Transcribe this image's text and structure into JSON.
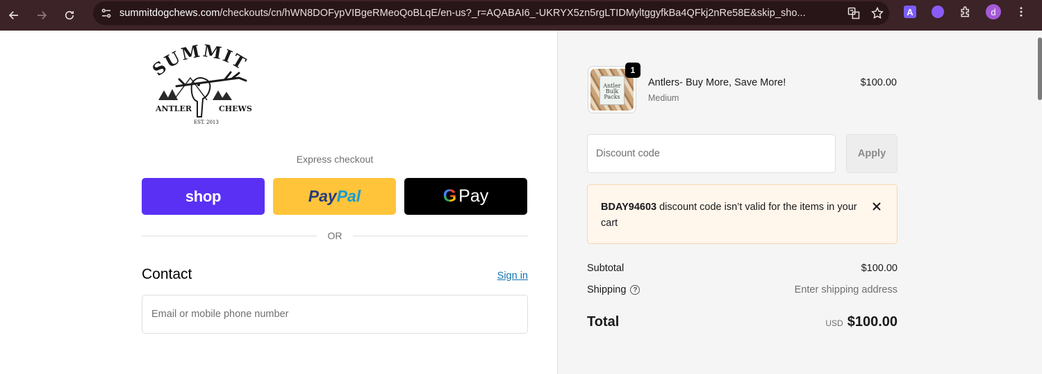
{
  "browser": {
    "url_host": "summitdogchews.com",
    "url_path": "/checkouts/cn/hWN8DOFypVIBgeRMeoQoBLqE/en-us?_r=AQABAI6_-UKRYX5zn5rgLTIDMyltggyfkBa4QFkj2nRe58E&skip_sho...",
    "extension_letter": "A",
    "profile_initial": "d",
    "icons": [
      "back-arrow-icon",
      "forward-arrow-icon",
      "reload-icon",
      "site-info-icon",
      "translate-icon",
      "bookmark-star-icon",
      "extensions-puzzle-icon",
      "more-vertical-icon"
    ]
  },
  "brand": {
    "logo_word": "SUMMIT",
    "logo_left": "ANTLER",
    "logo_right": "CHEWS",
    "logo_est": "EST. 2013"
  },
  "express": {
    "label": "Express checkout",
    "shop_label": "shop",
    "paypal_label_1": "Pay",
    "paypal_label_2": "Pal",
    "gpay_label_g": "G",
    "gpay_label": "Pay",
    "colors": {
      "shop": "#5a31f4",
      "paypal": "#ffc439",
      "gpay": "#000000"
    }
  },
  "divider": {
    "label": "OR"
  },
  "contact": {
    "heading": "Contact",
    "sign_in": "Sign in",
    "email_placeholder": "Email or mobile phone number"
  },
  "cart": {
    "item": {
      "name": "Antlers- Buy More, Save More!",
      "variant": "Medium",
      "price": "$100.00",
      "quantity": "1",
      "thumb_text": "Antler Bulk Packs"
    },
    "discount_placeholder": "Discount code",
    "apply_label": "Apply",
    "alert": {
      "code": "BDAY94603",
      "message": "discount code isn’t valid for the items in your cart"
    },
    "subtotal_label": "Subtotal",
    "subtotal_value": "$100.00",
    "shipping_label": "Shipping",
    "shipping_value": "Enter shipping address",
    "total_label": "Total",
    "total_currency": "USD",
    "total_value": "$100.00"
  },
  "colors": {
    "accent_link": "#1773b0",
    "alert_bg": "#fff6ec",
    "alert_border": "#f5d7b3",
    "chrome_bg": "#3c2327"
  }
}
